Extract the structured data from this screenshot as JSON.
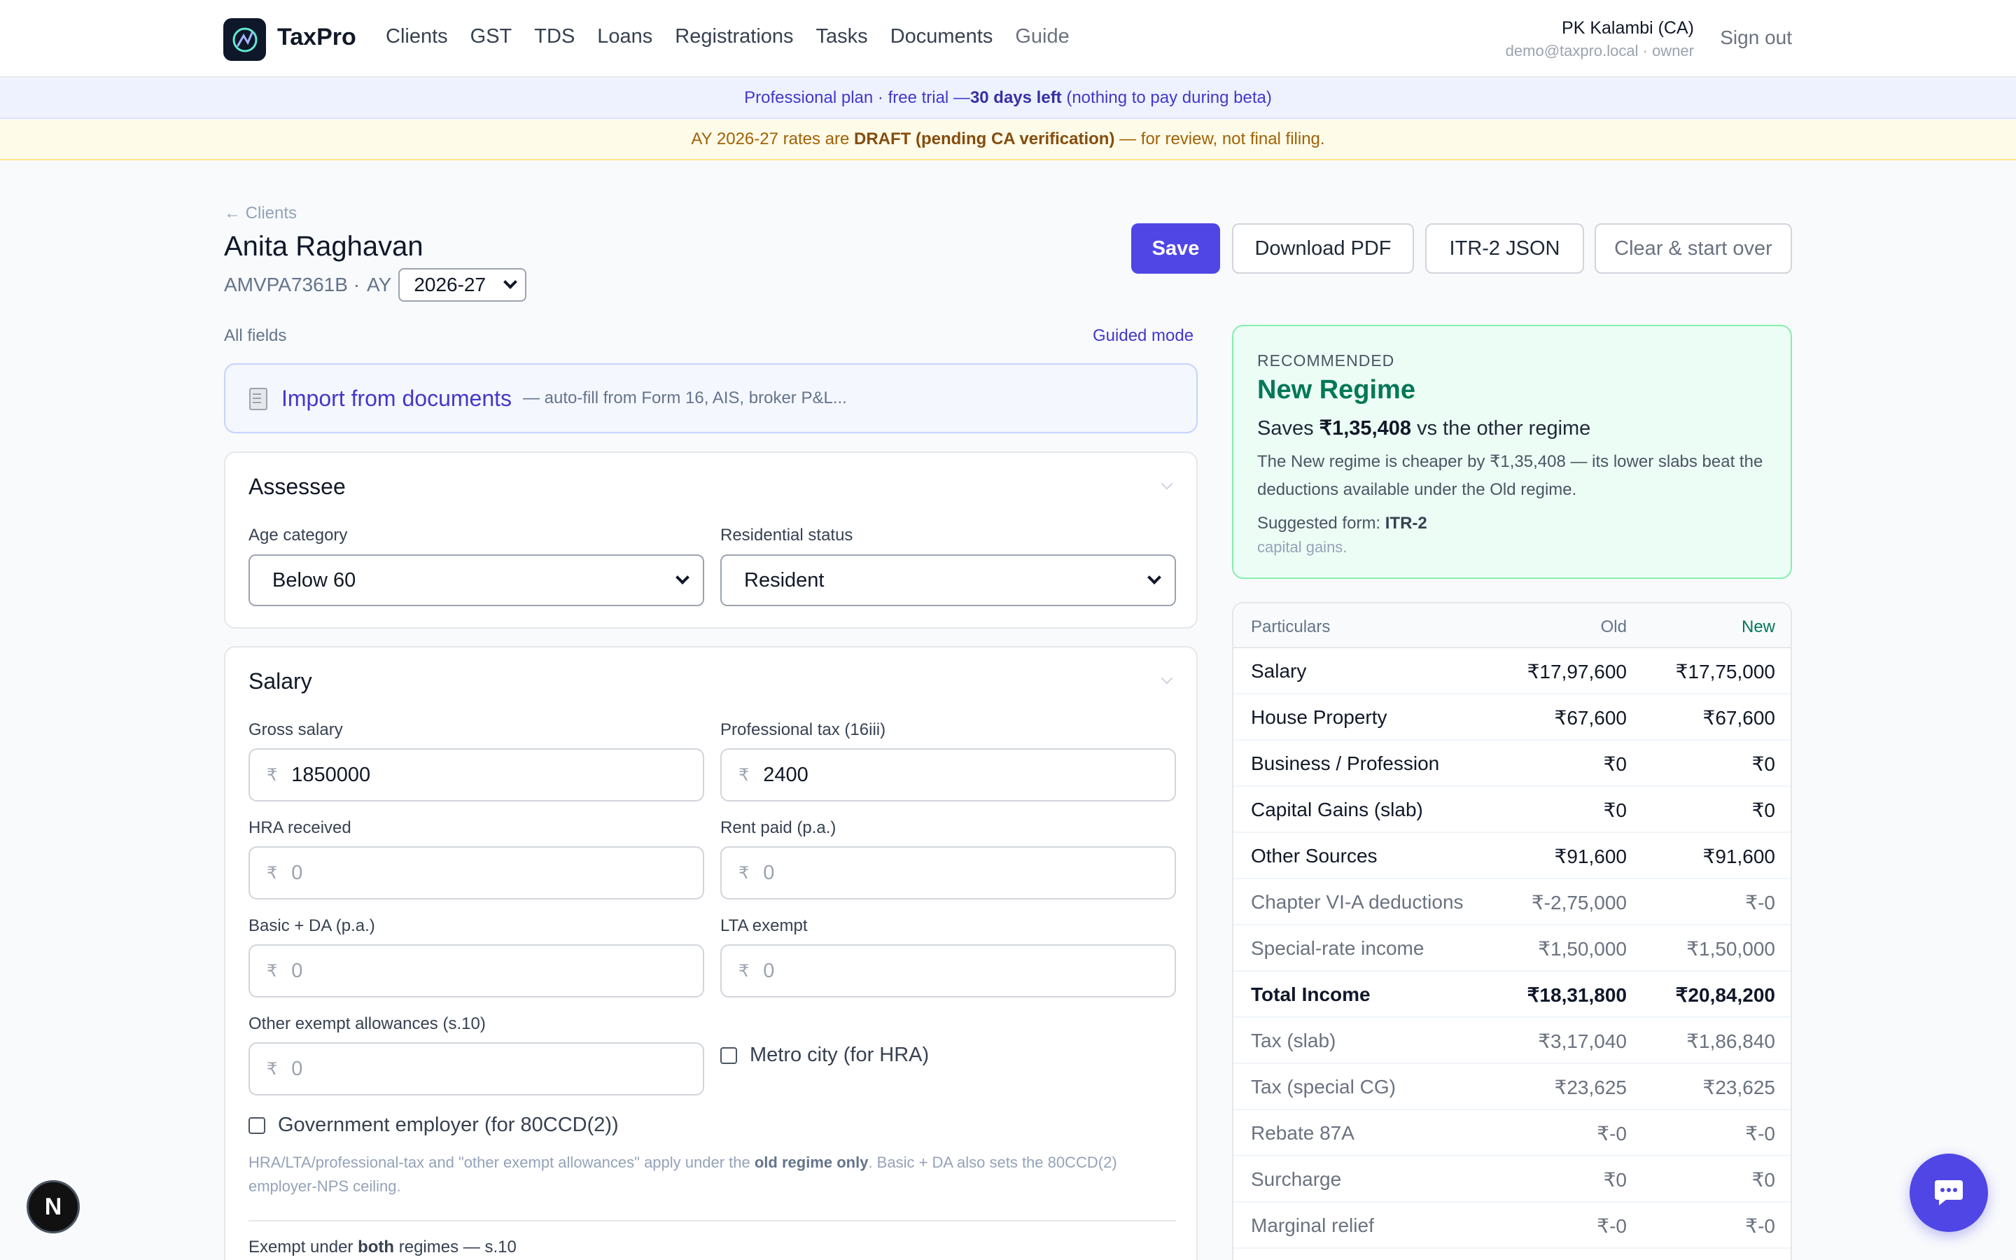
{
  "nav": {
    "brand": "TaxPro",
    "links": [
      "Clients",
      "GST",
      "TDS",
      "Loans",
      "Registrations",
      "Tasks",
      "Documents",
      "Guide"
    ],
    "user_name": "PK Kalambi (CA)",
    "user_meta": "demo@taxpro.local · owner",
    "sign_out": "Sign out"
  },
  "banners": {
    "plan_prefix": "Professional plan · free trial — ",
    "plan_bold": "30 days left",
    "plan_suffix": " (nothing to pay during beta)",
    "draft_prefix": "AY 2026-27 rates are ",
    "draft_bold": "DRAFT (pending CA verification)",
    "draft_suffix": " — for review, not final filing."
  },
  "header": {
    "back": "← Clients",
    "client_name": "Anita Raghavan",
    "pan": "AMVPA7361B ·",
    "ay_label": "AY",
    "ay_value": "2026-27",
    "buttons": {
      "save": "Save",
      "pdf": "Download PDF",
      "json": "ITR-2 JSON",
      "clear": "Clear & start over"
    }
  },
  "mode": {
    "all_fields": "All fields",
    "guided": "Guided mode"
  },
  "import": {
    "title": "Import from documents",
    "subtitle": "— auto-fill from Form 16, AIS, broker P&L..."
  },
  "assessee": {
    "title": "Assessee",
    "age_label": "Age category",
    "age_value": "Below 60",
    "res_label": "Residential status",
    "res_value": "Resident"
  },
  "salary": {
    "title": "Salary",
    "currency": "₹",
    "fields": {
      "gross": {
        "label": "Gross salary",
        "value": "1850000"
      },
      "prof_tax": {
        "label": "Professional tax (16iii)",
        "value": "2400"
      },
      "hra": {
        "label": "HRA received",
        "value": "0"
      },
      "rent": {
        "label": "Rent paid (p.a.)",
        "value": "0"
      },
      "basic": {
        "label": "Basic + DA (p.a.)",
        "value": "0"
      },
      "lta": {
        "label": "LTA exempt",
        "value": "0"
      },
      "other_exempt": {
        "label": "Other exempt allowances (s.10)",
        "value": "0"
      }
    },
    "metro_label": "Metro city (for HRA)",
    "govt_label": "Government employer (for 80CCD(2))",
    "note_a": "HRA/LTA/professional-tax and \"other exempt allowances\" apply under the ",
    "note_bold": "old regime only",
    "note_b": ". Basic + DA also sets the 80CCD(2) employer-NPS ceiling.",
    "exempt_prefix": "Exempt under ",
    "exempt_bold": "both",
    "exempt_suffix": " regimes — s.10"
  },
  "recommendation": {
    "kicker": "RECOMMENDED",
    "title": "New Regime",
    "saves_prefix": "Saves ",
    "saves_amount": "₹1,35,408",
    "saves_suffix": " vs the other regime",
    "desc": "The New regime is cheaper by ₹1,35,408 — its lower slabs beat the deductions available under the Old regime.",
    "form_prefix": "Suggested form: ",
    "form": "ITR-2",
    "form_note": "capital gains."
  },
  "comparison": {
    "headers": {
      "particulars": "Particulars",
      "old": "Old",
      "new": "New"
    },
    "rows": [
      {
        "label": "Salary",
        "old": "₹17,97,600",
        "new": "₹17,75,000"
      },
      {
        "label": "House Property",
        "old": "₹67,600",
        "new": "₹67,600"
      },
      {
        "label": "Business / Profession",
        "old": "₹0",
        "new": "₹0"
      },
      {
        "label": "Capital Gains (slab)",
        "old": "₹0",
        "new": "₹0"
      },
      {
        "label": "Other Sources",
        "old": "₹91,600",
        "new": "₹91,600"
      },
      {
        "label": "Chapter VI-A deductions",
        "old": "₹-2,75,000",
        "new": "₹-0"
      },
      {
        "label": "Special-rate income",
        "old": "₹1,50,000",
        "new": "₹1,50,000"
      },
      {
        "label": "Total Income",
        "old": "₹18,31,800",
        "new": "₹20,84,200"
      },
      {
        "label": "Tax (slab)",
        "old": "₹3,17,040",
        "new": "₹1,86,840"
      },
      {
        "label": "Tax (special CG)",
        "old": "₹23,625",
        "new": "₹23,625"
      },
      {
        "label": "Rebate 87A",
        "old": "₹-0",
        "new": "₹-0"
      },
      {
        "label": "Surcharge",
        "old": "₹0",
        "new": "₹0"
      },
      {
        "label": "Marginal relief",
        "old": "₹-0",
        "new": "₹-0"
      }
    ]
  },
  "floating": {
    "badge": "N"
  },
  "colors": {
    "accent": "#4f46e5",
    "success": "#047857",
    "draft": "#854d0e"
  }
}
